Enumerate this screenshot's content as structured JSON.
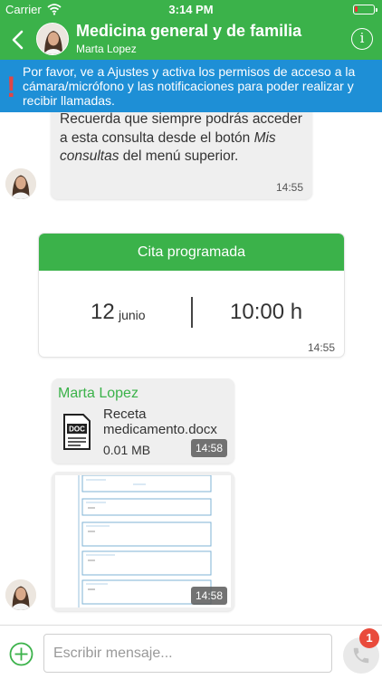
{
  "status_bar": {
    "carrier": "Carrier",
    "time": "3:14 PM"
  },
  "header": {
    "title": "Medicina general y de familia",
    "subtitle": "Marta Lopez"
  },
  "banner": {
    "icon": "warning-icon",
    "text": "Por favor, ve a Ajustes y activa los permisos de acceso a la cámara/micrófono y las notificaciones para poder realizar y recibir llamadas."
  },
  "messages": {
    "m1": {
      "text_before": "Recuerda que siempre podrás acceder a esta consulta desde el botón ",
      "text_italic": "Mis consultas",
      "text_after": " del menú superior.",
      "time": "14:55"
    },
    "appointment": {
      "title": "Cita programada",
      "day": "12",
      "month": "junio",
      "hour": "10:00 h",
      "time": "14:55"
    },
    "file": {
      "sender": "Marta Lopez",
      "icon_label": "DOC",
      "filename": "Receta medicamento.docx",
      "size": "0.01 MB",
      "time": "14:58"
    },
    "image": {
      "time": "14:58"
    }
  },
  "footer": {
    "placeholder": "Escribir mensaje...",
    "badge_count": "1"
  },
  "colors": {
    "brand_green": "#3bb24a",
    "banner_blue": "#1e8fd6",
    "badge_red": "#e94b3c",
    "warning_red": "#e04646"
  }
}
